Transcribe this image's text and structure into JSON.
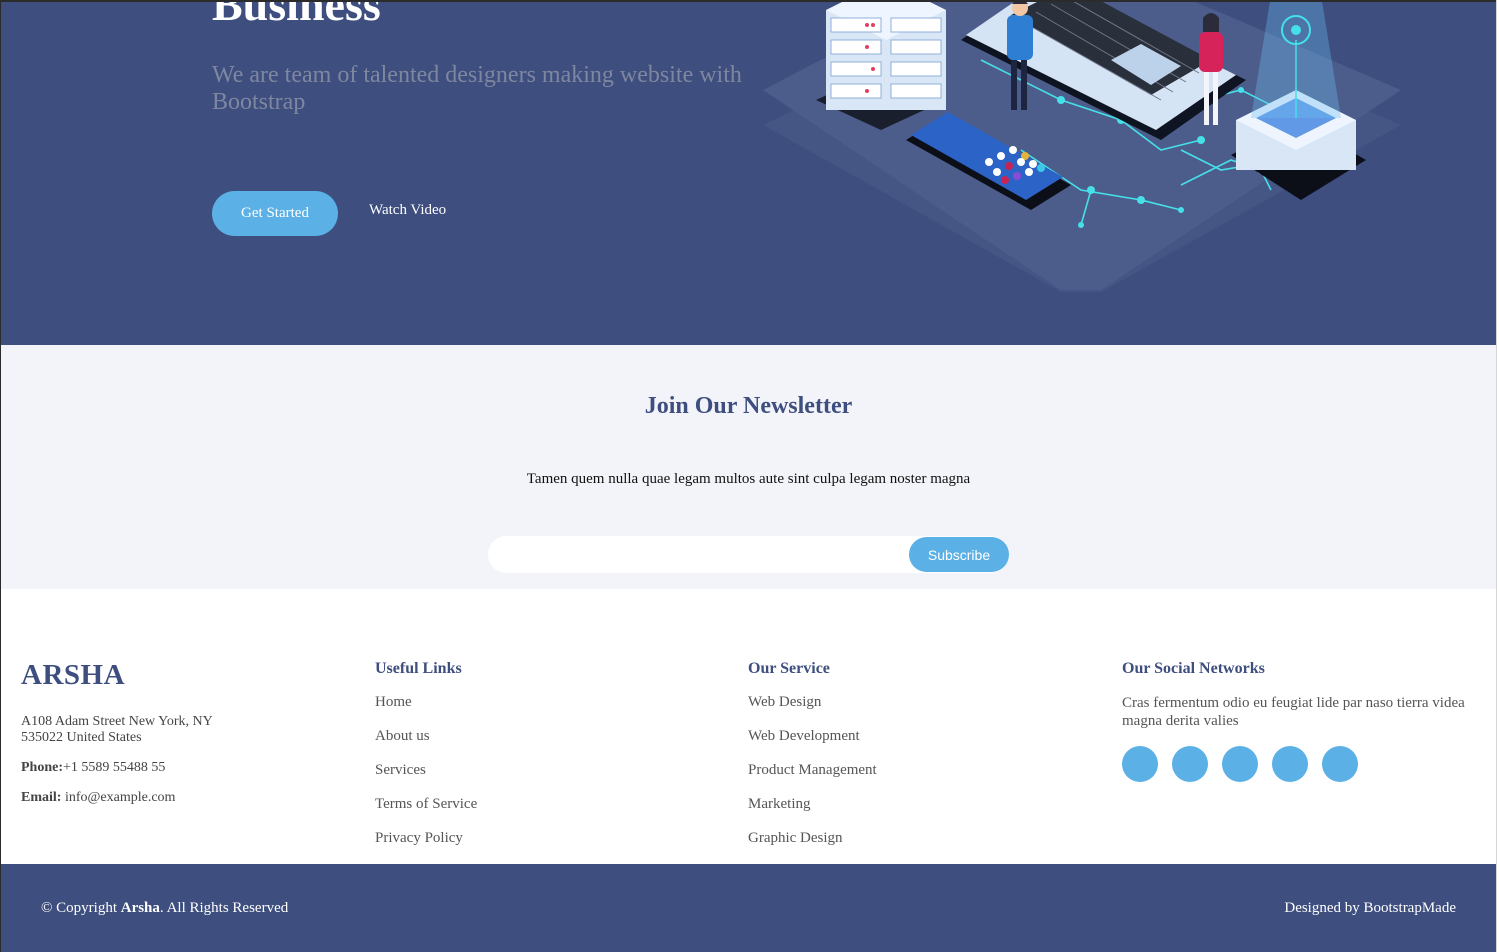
{
  "hero": {
    "title": "Business",
    "subtitle": "We are team of talented designers making website with Bootstrap",
    "get_started_label": "Get Started",
    "watch_video_label": "Watch Video"
  },
  "newsletter": {
    "title": "Join Our Newsletter",
    "description": "Tamen quem nulla quae legam multos aute sint culpa legam noster magna",
    "email_value": "",
    "subscribe_label": "Subscribe"
  },
  "footer": {
    "brand": "ARSHA",
    "address": "A108 Adam Street New York, NY 535022 United States",
    "phone_label": "Phone:",
    "phone_value": "+1 5589 55488 55",
    "email_label": "Email:",
    "email_value": " info@example.com",
    "useful_links": {
      "title": "Useful Links",
      "items": [
        "Home",
        "About us",
        "Services",
        "Terms of Service",
        "Privacy Policy"
      ]
    },
    "services": {
      "title": "Our Service",
      "items": [
        "Web Design",
        "Web Development",
        "Product Management",
        "Marketing",
        "Graphic Design"
      ]
    },
    "social": {
      "title": "Our Social Networks",
      "text": "Cras fermentum odio eu feugiat lide par naso tierra videa magna derita valies",
      "icons": [
        "twitter-icon",
        "facebook-icon",
        "instagram-icon",
        "skype-icon",
        "linkedin-icon"
      ]
    },
    "copyright_prefix": "© Copyright ",
    "copyright_brand": "Arsha",
    "copyright_suffix": ". All Rights Reserved",
    "credits": "Designed by BootstrapMade"
  },
  "colors": {
    "hero_bg": "#3d4e7f",
    "accent": "#5bb0e6",
    "newsletter_bg": "#f3f4f9"
  }
}
